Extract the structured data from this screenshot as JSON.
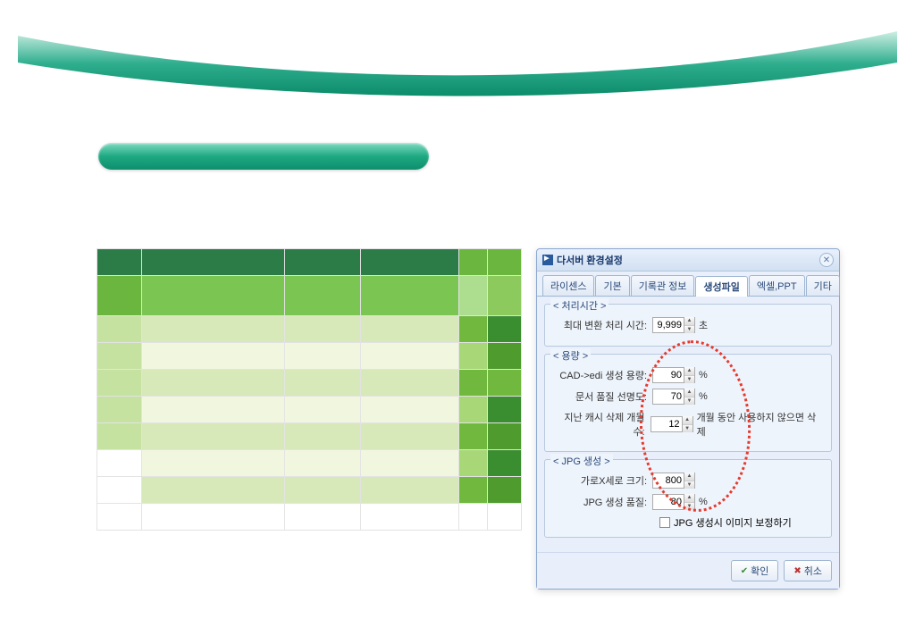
{
  "dialog": {
    "title": "다서버 환경설정",
    "tabs": [
      "라이센스",
      "기본",
      "기록관 정보",
      "생성파일",
      "엑셀,PPT",
      "기타"
    ],
    "active_tab": "생성파일",
    "groups": {
      "processing": {
        "legend": "< 처리시간 >",
        "max_convert_label": "최대 변환 처리 시간:",
        "max_convert_value": "9,999",
        "max_convert_unit": "초"
      },
      "capacity": {
        "legend": "< 용량 >",
        "cad_label": "CAD->edi 생성 용량:",
        "cad_value": "90",
        "cad_unit": "%",
        "doc_label": "문서 품질 선명도:",
        "doc_value": "70",
        "doc_unit": "%",
        "cache_label": "지난 캐시 삭제 개월수:",
        "cache_value": "12",
        "cache_suffix": "개월 동안 사용하지 않으면 삭제"
      },
      "jpg": {
        "legend": "< JPG 생성 >",
        "size_label": "가로X세로 크기:",
        "size_value": "800",
        "quality_label": "JPG 생성 품질:",
        "quality_value": "80",
        "quality_unit": "%",
        "checkbox_label": "JPG 생성시 이미지 보정하기"
      }
    },
    "buttons": {
      "ok": "확인",
      "cancel": "취소"
    }
  }
}
